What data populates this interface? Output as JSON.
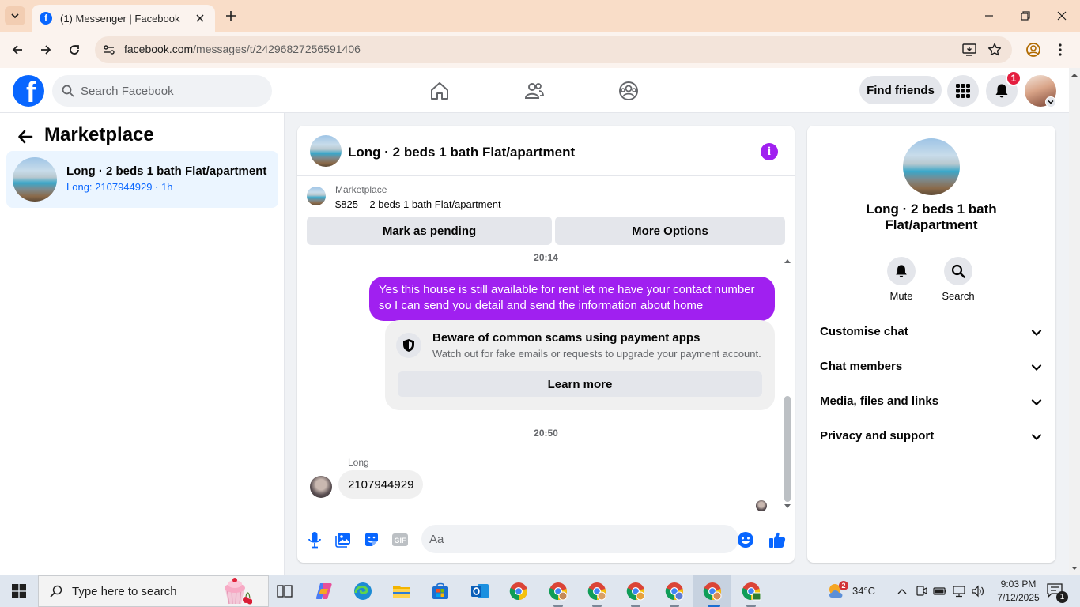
{
  "browser": {
    "tab_title": "(1) Messenger | Facebook",
    "url_domain": "facebook.com",
    "url_path": "/messages/t/24296827256591406"
  },
  "fb_nav": {
    "search_placeholder": "Search Facebook",
    "find_friends_label": "Find friends",
    "notification_count": "1",
    "brand_color": "#0866ff"
  },
  "left_panel": {
    "title": "Marketplace",
    "conversations": [
      {
        "title": "Long · 2 beds 1 bath Flat/apartment",
        "subtitle": "Long: 2107944929 · 1h"
      }
    ]
  },
  "chat": {
    "header_title": "Long · 2 beds 1 bath Flat/apartment",
    "info_icon": "i",
    "marketplace_label": "Marketplace",
    "listing_price_title": "$825 – 2 beds 1 bath Flat/apartment",
    "mark_pending_label": "Mark as pending",
    "more_options_label": "More Options",
    "timestamp_1": "20:14",
    "outgoing_message": "Yes this house is still available for rent let me have your contact number so I can send you detail and send the information about home",
    "scam_title": "Beware of common scams using payment apps",
    "scam_description": "Watch out for fake emails or requests to upgrade your payment account.",
    "learn_more_label": "Learn more",
    "timestamp_2": "20:50",
    "sender_name": "Long",
    "incoming_message": "2107944929",
    "composer_placeholder": "Aa",
    "accent_color": "#a020f0"
  },
  "info_panel": {
    "title": "Long · 2 beds 1 bath Flat/apartment",
    "actions": [
      {
        "label": "Mute",
        "icon": "bell-icon"
      },
      {
        "label": "Search",
        "icon": "search-icon"
      }
    ],
    "sections": [
      {
        "label": "Customise chat"
      },
      {
        "label": "Chat members"
      },
      {
        "label": "Media, files and links"
      },
      {
        "label": "Privacy and support"
      }
    ]
  },
  "taskbar": {
    "search_placeholder": "Type here to search",
    "weather_temp": "34°C",
    "weather_badge": "2",
    "time": "9:03 PM",
    "date": "7/12/2025",
    "notification_count": "1"
  }
}
